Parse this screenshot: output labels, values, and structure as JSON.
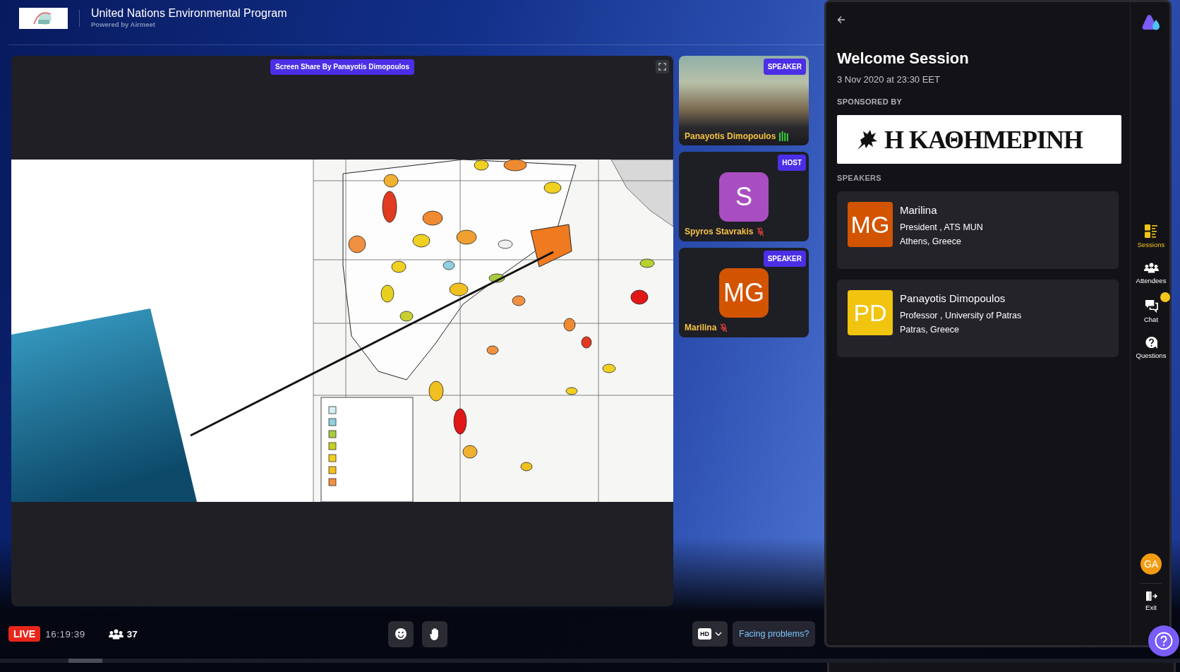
{
  "header": {
    "title": "United Nations Environmental Program",
    "subtitle": "Powered by Airmeet"
  },
  "stage": {
    "screen_share_label": "Screen Share By Panayotis Dimopoulos"
  },
  "participants": [
    {
      "kind": "video",
      "name": "Panayotis Dimopoulos",
      "role": "SPEAKER",
      "muted": false
    },
    {
      "kind": "avatar",
      "initials": "S",
      "color": "#a94ec1",
      "name": "Spyros Stavrakis",
      "role": "HOST",
      "muted": true
    },
    {
      "kind": "avatar",
      "initials": "MG",
      "color": "#d35400",
      "name": "Marilina",
      "role": "SPEAKER",
      "muted": true
    }
  ],
  "bottom_bar": {
    "live_label": "LIVE",
    "clock": "16:19:39",
    "attendee_count": "37",
    "quality": "HD",
    "help_link": "Facing problems?"
  },
  "session_panel": {
    "title": "Welcome Session",
    "datetime": "3 Nov 2020 at 23:30 EET",
    "sponsor_heading": "SPONSORED BY",
    "sponsor_name": "Η ΚΑΘΗΜΕΡΙΝΗ",
    "speakers_heading": "SPEAKERS",
    "speakers": [
      {
        "initials": "MG",
        "color": "#d35400",
        "name": "Marilina",
        "title": "President , ATS MUN",
        "location": "Athens, Greece"
      },
      {
        "initials": "PD",
        "color": "#f1c40f",
        "name": "Panayotis Dimopoulos",
        "title": "Professor , University of Patras",
        "location": "Patras, Greece"
      }
    ]
  },
  "rail": {
    "items": [
      {
        "kind": "sessions",
        "label": "Sessions",
        "selected": true,
        "unread": false
      },
      {
        "kind": "attendees",
        "label": "Attendees",
        "selected": false,
        "unread": false
      },
      {
        "kind": "chat",
        "label": "Chat",
        "selected": false,
        "unread": true
      },
      {
        "kind": "questions",
        "label": "Questions",
        "selected": false,
        "unread": false
      }
    ],
    "user_initials": "GA",
    "exit_label": "Exit"
  }
}
